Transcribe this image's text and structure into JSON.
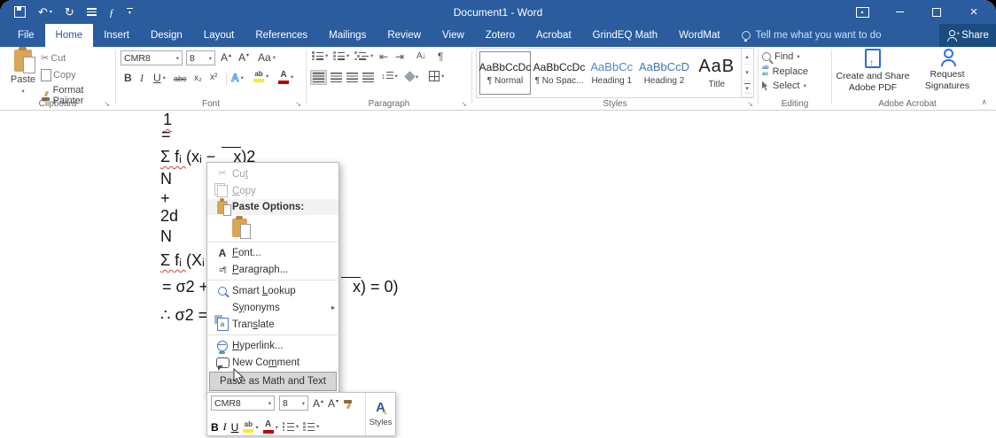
{
  "colors": {
    "titlebar_blue": "#2a5c9e",
    "accent_blue": "#2b579a",
    "share_bg": "#1a4c80",
    "heading_blue": "#4e86c8",
    "highlight_yellow": "#ffe92b",
    "font_color_red": "#c00000",
    "squiggle_red": "#d24040"
  },
  "icons": {
    "dropdown": "▾",
    "submenu_arrow": "▸",
    "scissors": "✂",
    "pilcrow": "¶",
    "undo": "↶",
    "redo": "↻",
    "close": "×",
    "grow_font": "A",
    "shrink_font": "A",
    "change_case": "Aa",
    "bold": "B",
    "italic": "I",
    "underline": "U",
    "strikethrough": "abc",
    "subscript": "x₂",
    "superscript": "x²",
    "text_effects": "A",
    "highlight_letters": "ab",
    "font_color_letter": "A",
    "dec_indent": "⇤",
    "inc_indent": "⇥",
    "sort": "A↓",
    "line_spacing": "↕",
    "up_small": "▴",
    "down_small": "▾",
    "collapse_ribbon": "∧",
    "launcher": "↘",
    "font_dialog": "A",
    "paragraph_dialog": "≡¶",
    "translate_letter": "a",
    "replace_top": "ab",
    "replace_bottom": "ac",
    "pdf_arrow": "↑",
    "share_plus": "+",
    "wordmat_f": "ƒ",
    "styles_a": "A",
    "styles_pen": "✎"
  },
  "titlebar": {
    "title": "Document1 - Word"
  },
  "tabs": {
    "items": [
      "File",
      "Home",
      "Insert",
      "Design",
      "Layout",
      "References",
      "Mailings",
      "Review",
      "View",
      "Zotero",
      "Acrobat",
      "GrindEQ Math",
      "WordMat"
    ],
    "tell_me": "Tell me what you want to do",
    "share": "Share"
  },
  "ribbon": {
    "clipboard": {
      "label": "Clipboard",
      "paste": "Paste",
      "cut": "Cut",
      "copy": "Copy",
      "format_painter": "Format Painter"
    },
    "font": {
      "label": "Font",
      "font_name": "CMR8",
      "font_size": "8"
    },
    "paragraph": {
      "label": "Paragraph"
    },
    "styles": {
      "label": "Styles",
      "items": [
        {
          "sample": "AaBbCcDc",
          "name": "¶ Normal"
        },
        {
          "sample": "AaBbCcDc",
          "name": "¶ No Spac..."
        },
        {
          "sample": "AaBbCc",
          "name": "Heading 1"
        },
        {
          "sample": "AaBbCcD",
          "name": "Heading 2"
        },
        {
          "sample": "AaB",
          "name": "Title"
        }
      ]
    },
    "editing": {
      "label": "Editing",
      "find": "Find",
      "replace": "Replace",
      "select": "Select"
    },
    "acrobat": {
      "label": "Adobe Acrobat",
      "create_line1": "Create and Share",
      "create_line2": "Adobe PDF",
      "request_line1": "Request",
      "request_line2": "Signatures"
    }
  },
  "document": {
    "line1": "1",
    "line2": "=",
    "line3": {
      "spell": "Σ fᵢ ",
      "mid": "(xᵢ − ",
      "bar": "x",
      "end": ")2"
    },
    "line4": "N",
    "line5": "+",
    "line6": "2d",
    "line7": "N",
    "line8": {
      "spell": "Σ fᵢ ",
      "mid": "(Xᵢ −"
    },
    "line9": {
      "left": "= σ2 + ",
      "bar": "x",
      "end": ") = 0)"
    },
    "line10": "∴ σ2 ="
  },
  "context_menu": {
    "cut": "Cu<u>t</u>",
    "copy": "<u>C</u>opy",
    "paste_options": "Paste Options:",
    "font": "<u>F</u>ont...",
    "paragraph": "<u>P</u>aragraph...",
    "smart_lookup": "Smart <u>L</u>ookup",
    "synonyms": "S<u>y</u>nonyms",
    "translate": "Tran<u>s</u>late",
    "hyperlink": "<u>H</u>yperlink...",
    "new_comment": "New Co<u>m</u>ment",
    "paste_math": "Paste as Math and Text"
  },
  "mini_toolbar": {
    "font_name": "CMR8",
    "font_size": "8",
    "styles_label": "Styles"
  }
}
